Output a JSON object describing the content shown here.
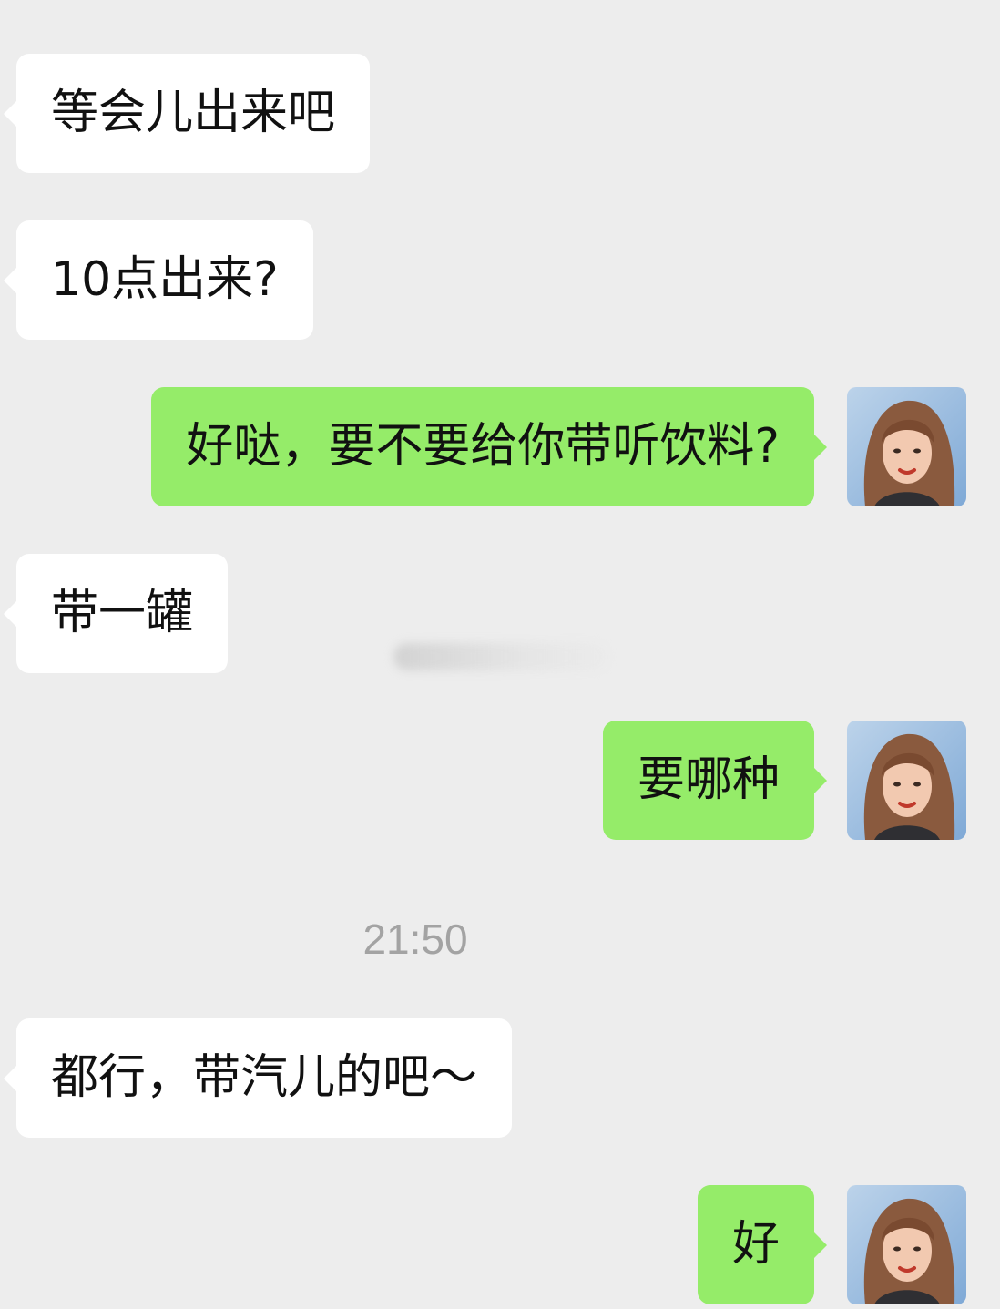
{
  "messages": [
    {
      "side": "in",
      "text": "等会儿出来吧"
    },
    {
      "side": "in",
      "text": "10点出来?"
    },
    {
      "side": "out",
      "text": "好哒，要不要给你带听饮料?"
    },
    {
      "side": "in",
      "text": "带一罐"
    },
    {
      "side": "out",
      "text": "要哪种"
    },
    {
      "side": "in",
      "text": "都行，带汽儿的吧～"
    },
    {
      "side": "out",
      "text": "好"
    }
  ],
  "timestamp": "21:50",
  "colors": {
    "background": "#ededed",
    "incoming_bubble": "#ffffff",
    "outgoing_bubble": "#95ec69",
    "timestamp_text": "#a3a3a3"
  },
  "icons": {
    "self_avatar": "user-avatar-photo"
  }
}
